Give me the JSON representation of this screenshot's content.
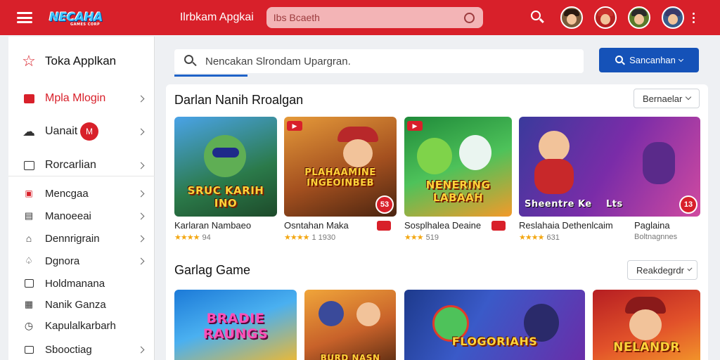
{
  "topbar": {
    "logo": "NECAHA",
    "logo_sub": "GAMES CORP",
    "title": "Ilrbkam Apgkai",
    "search_placeholder": "Ibs Bcaeth"
  },
  "sidebar": {
    "items": [
      {
        "label": "Toka Applkan",
        "icon": "star-icon"
      },
      {
        "label": "Mpla Mlogin",
        "icon": "app-box-icon"
      },
      {
        "label": "Uanait",
        "badge": "M",
        "icon": "cloud-icon"
      },
      {
        "label": "Rorcarlian",
        "icon": "mail-icon"
      },
      {
        "label": "Mencgaa",
        "icon": "play-icon"
      },
      {
        "label": "Manoeeai",
        "icon": "clipboard-icon"
      },
      {
        "label": "Dennrigrain",
        "icon": "shield-icon"
      },
      {
        "label": "Dgnora",
        "icon": "bell-icon"
      },
      {
        "label": "Holdmanana",
        "icon": "image-icon"
      },
      {
        "label": "Nanik Ganza",
        "icon": "calendar-icon"
      },
      {
        "label": "Kapulalkarbarh",
        "icon": "clock-icon"
      },
      {
        "label": "Sbooctiag",
        "icon": "keyboard-icon"
      }
    ]
  },
  "main": {
    "search_placeholder": "Nencakan Slrondam Upargran.",
    "search_button": "Sancanhan",
    "section1": {
      "title": "Darlan Nanih Rroalgan",
      "sort_label": "Bernaelar",
      "games": [
        {
          "title_art": "SRUC KARIH INO",
          "name": "Karlaran Nambaeo",
          "stars": "★★★★",
          "rating": "94",
          "colors": [
            "#3f8fd6",
            "#1b5a3a"
          ]
        },
        {
          "title_art": "PLAHAAMINE INGEOINBEB",
          "name": "Osntahan Maka",
          "stars": "★★★★",
          "rating": "1 1930",
          "badge": "53",
          "colors": [
            "#c46a2a",
            "#5b2c12"
          ]
        },
        {
          "title_art": "NENERING LABAAH",
          "name": "Sosplhalea Deaine",
          "stars": "★★★",
          "rating": "519",
          "colors": [
            "#2fa34a",
            "#ff9a1f"
          ]
        },
        {
          "title_art": "Sheentre Ke",
          "title_art2": "Lts",
          "name": "Reslahaia Dethenlcaim",
          "stars": "★★★★",
          "rating": "631",
          "name2": "Paglaina",
          "sub2": "Boltnagnnes",
          "badge": "13",
          "colors": [
            "#5a2c9c",
            "#c13a8a"
          ]
        }
      ]
    },
    "section2": {
      "title": "Garlag Game",
      "sort_label": "Reakdegrdr",
      "games": [
        {
          "title_art": "BRADIE RAUNGS",
          "colors": [
            "#1c7ad8",
            "#f5b92a"
          ]
        },
        {
          "title_art": "BURD NASN",
          "colors": [
            "#e48a2a",
            "#6a3b1b"
          ]
        },
        {
          "title_art": "FLOGORIAHS",
          "colors": [
            "#1d3a8c",
            "#6a2ca8"
          ]
        },
        {
          "title_art": "NELANDR",
          "colors": [
            "#b61e22",
            "#f39a2a"
          ]
        }
      ]
    }
  }
}
